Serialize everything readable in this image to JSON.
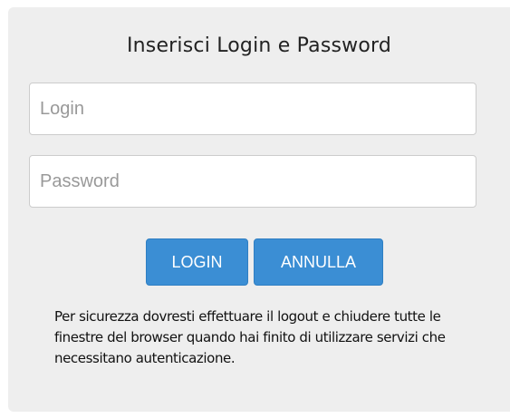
{
  "login_panel": {
    "title": "Inserisci Login e Password",
    "login_field": {
      "value": "",
      "placeholder": "Login"
    },
    "password_field": {
      "value": "",
      "placeholder": "Password"
    },
    "buttons": {
      "login_label": "LOGIN",
      "cancel_label": "ANNULLA"
    },
    "security_notice": "Per sicurezza dovresti effettuare il logout e chiudere tutte le finestre del browser quando hai finito di utilizzare servizi che necessitano autenticazione."
  },
  "colors": {
    "panel_background": "#eeeeee",
    "button_primary": "#3b8ed4",
    "button_text": "#ffffff"
  }
}
